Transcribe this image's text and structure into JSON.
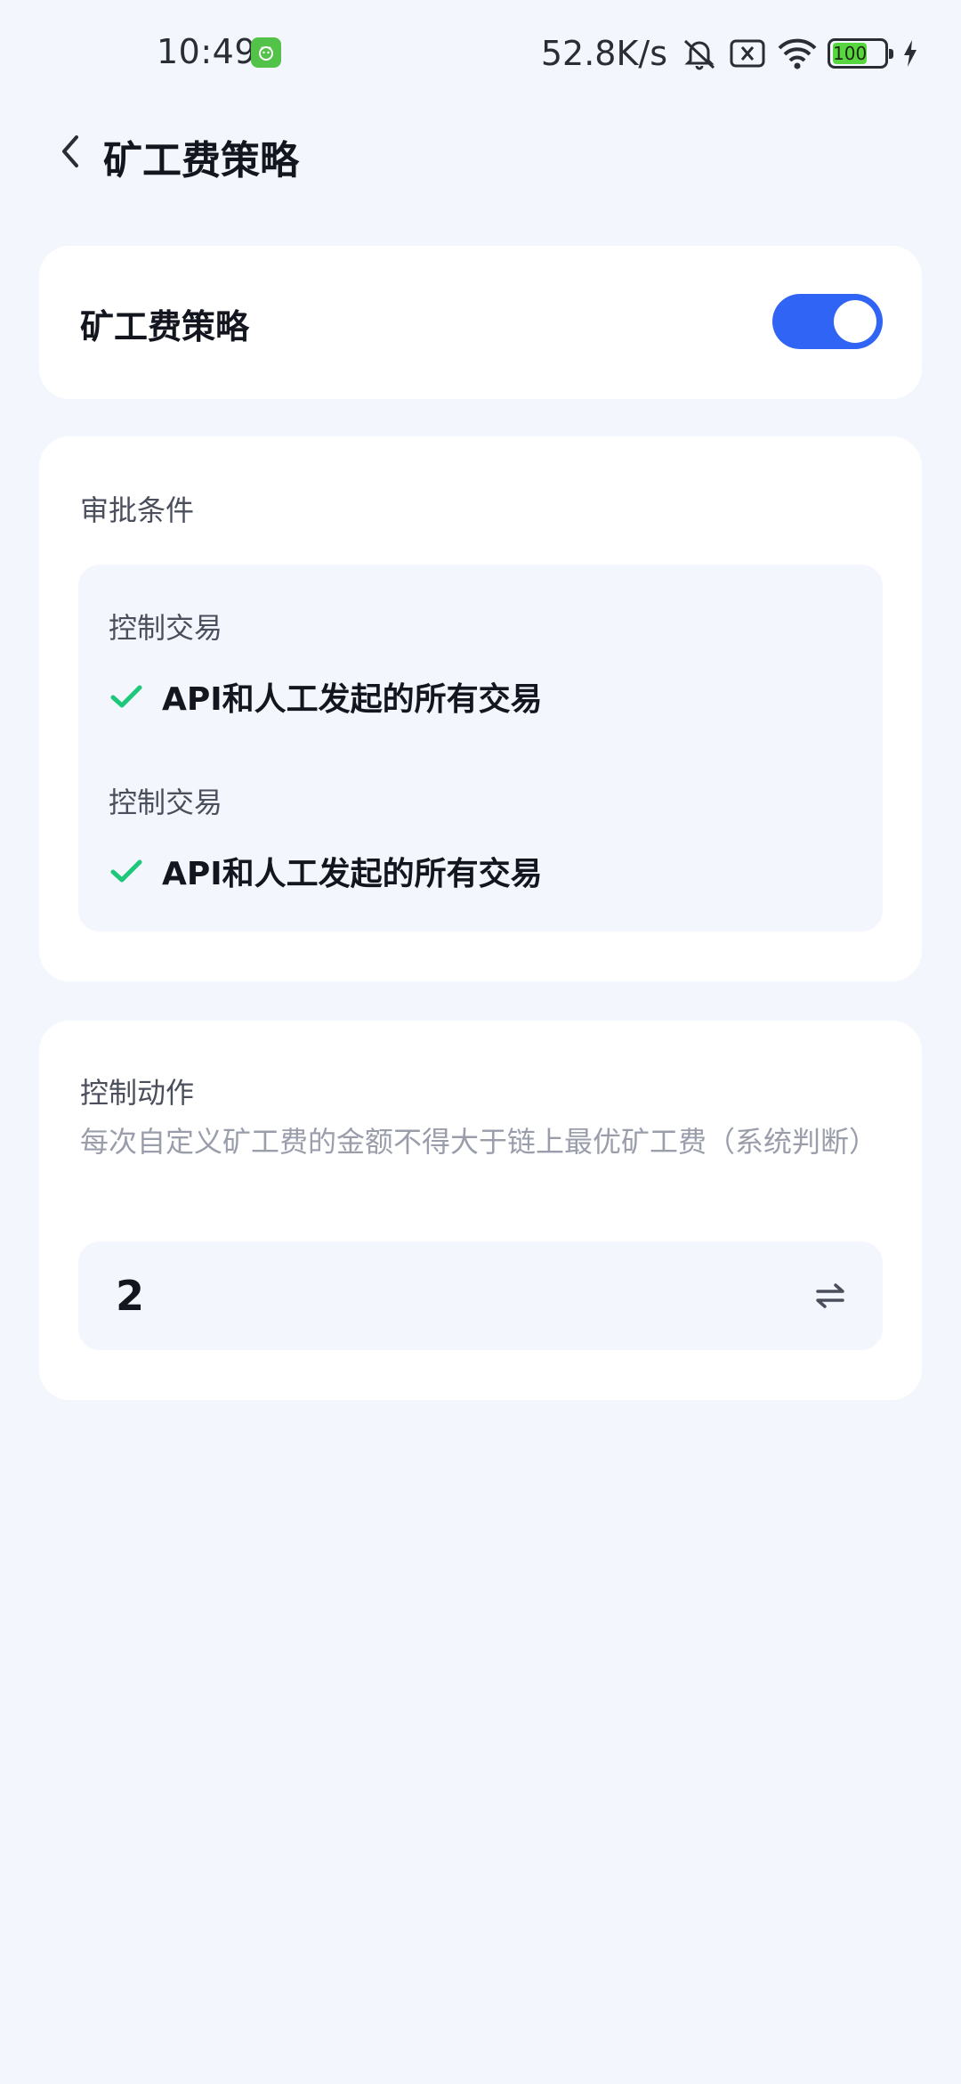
{
  "status_bar": {
    "time": "10:49",
    "net_speed": "52.8K/s",
    "battery_level": "100"
  },
  "header": {
    "title": "矿工费策略"
  },
  "policy_toggle": {
    "label": "矿工费策略",
    "enabled": true,
    "color": "#2f64f5"
  },
  "approval": {
    "section_label": "审批条件",
    "conditions": [
      {
        "label": "控制交易",
        "value": "API和人工发起的所有交易"
      },
      {
        "label": "控制交易",
        "value": "API和人工发起的所有交易"
      }
    ],
    "check_color": "#1ec87a"
  },
  "action": {
    "section_label": "控制动作",
    "description": "每次自定义矿工费的金额不得大于链上最优矿工费（系统判断）",
    "amount_value": "2"
  }
}
